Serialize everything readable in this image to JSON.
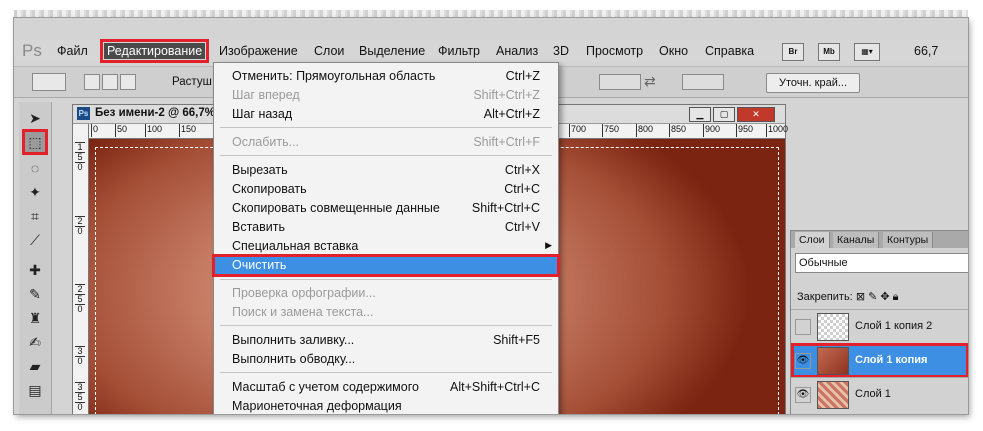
{
  "app": {
    "logo": "Ps"
  },
  "menubar": {
    "items": [
      "Файл",
      "Редактирование",
      "Изображение",
      "Слои",
      "Выделение",
      "Фильтр",
      "Анализ",
      "3D",
      "Просмотр",
      "Окно",
      "Справка"
    ],
    "active": "Редактирование",
    "buttons": [
      "Br",
      "Mb"
    ],
    "zoom": "66,7"
  },
  "options_bar": {
    "feather_label": "Растуш",
    "refine_edge": "Уточн. край..."
  },
  "document": {
    "title": "Без имени-2 @ 66,7%",
    "ruler_h": [
      "0",
      "50",
      "100",
      "150",
      "700",
      "750",
      "800",
      "850",
      "900",
      "950",
      "1000"
    ],
    "ruler_v": [
      "1",
      "5",
      "0",
      "2",
      "0",
      "2",
      "5",
      "0",
      "3",
      "0",
      "3",
      "5",
      "0"
    ]
  },
  "edit_menu": {
    "items": [
      {
        "label": "Отменить: Прямоугольная область",
        "shortcut": "Ctrl+Z",
        "disabled": false
      },
      {
        "label": "Шаг вперед",
        "shortcut": "Shift+Ctrl+Z",
        "disabled": true
      },
      {
        "label": "Шаг назад",
        "shortcut": "Alt+Ctrl+Z",
        "disabled": false
      },
      {
        "label": "Ослабить...",
        "shortcut": "Shift+Ctrl+F",
        "disabled": true
      },
      {
        "label": "Вырезать",
        "shortcut": "Ctrl+X",
        "disabled": false
      },
      {
        "label": "Скопировать",
        "shortcut": "Ctrl+C",
        "disabled": false
      },
      {
        "label": "Скопировать совмещенные данные",
        "shortcut": "Shift+Ctrl+C",
        "disabled": false
      },
      {
        "label": "Вставить",
        "shortcut": "Ctrl+V",
        "disabled": false
      },
      {
        "label": "Специальная вставка",
        "shortcut": "",
        "disabled": false
      },
      {
        "label": "Очистить",
        "shortcut": "",
        "disabled": false
      },
      {
        "label": "Проверка орфографии...",
        "shortcut": "",
        "disabled": true
      },
      {
        "label": "Поиск и замена текста...",
        "shortcut": "",
        "disabled": true
      },
      {
        "label": "Выполнить заливку...",
        "shortcut": "Shift+F5",
        "disabled": false
      },
      {
        "label": "Выполнить обводку...",
        "shortcut": "",
        "disabled": false
      },
      {
        "label": "Масштаб с учетом содержимого",
        "shortcut": "Alt+Shift+Ctrl+C",
        "disabled": false
      },
      {
        "label": "Марионеточная деформация",
        "shortcut": "",
        "disabled": false
      }
    ],
    "highlighted": "Очистить"
  },
  "layers_panel": {
    "tabs": [
      "Слои",
      "Каналы",
      "Контуры"
    ],
    "blend_mode": "Обычные",
    "lock_label": "Закрепить:",
    "layers": [
      {
        "name": "Слой 1 копия 2",
        "visible": false,
        "selected": false
      },
      {
        "name": "Слой 1 копия",
        "visible": true,
        "selected": true
      },
      {
        "name": "Слой 1",
        "visible": true,
        "selected": false
      }
    ]
  },
  "colors": {
    "highlight": "#3d8fe4",
    "annotation_red": "#e3212a"
  }
}
